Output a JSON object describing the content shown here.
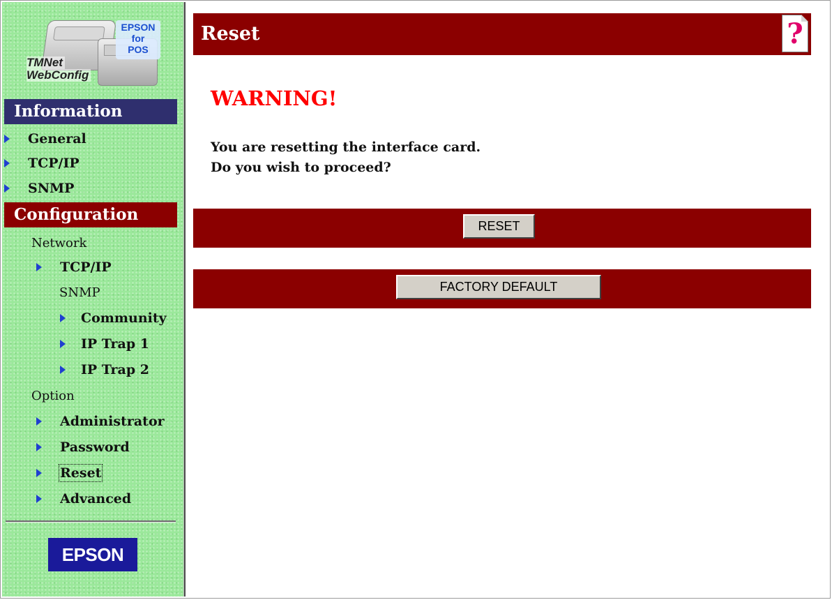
{
  "logo": {
    "brand_badge": "EPSON\nfor\nPOS",
    "product_line1": "TMNet",
    "product_line2": "WebConfig"
  },
  "sidebar": {
    "information": {
      "heading": "Information",
      "items": [
        {
          "label": "General"
        },
        {
          "label": "TCP/IP"
        },
        {
          "label": "SNMP"
        }
      ]
    },
    "configuration": {
      "heading": "Configuration",
      "network_label": "Network",
      "network_tcpip": "TCP/IP",
      "snmp_label": "SNMP",
      "snmp_items": [
        {
          "label": "Community"
        },
        {
          "label": "IP Trap 1"
        },
        {
          "label": "IP Trap 2"
        }
      ],
      "option_label": "Option",
      "option_items": [
        {
          "label": "Administrator"
        },
        {
          "label": "Password"
        },
        {
          "label": "Reset"
        },
        {
          "label": "Advanced"
        }
      ]
    },
    "footer_logo": "EPSON"
  },
  "main": {
    "title": "Reset",
    "help_icon": "?",
    "warning": "WARNING!",
    "message_line1": "You are resetting the interface card.",
    "message_line2": "Do you wish to proceed?",
    "reset_button": "RESET",
    "factory_default_button": "FACTORY DEFAULT"
  },
  "colors": {
    "sidebar_bg": "#9be89b",
    "info_head_bg": "#2f2f6e",
    "accent_red": "#8b0000",
    "warning_red": "#ff0000",
    "arrow_blue": "#1f3fd0"
  }
}
